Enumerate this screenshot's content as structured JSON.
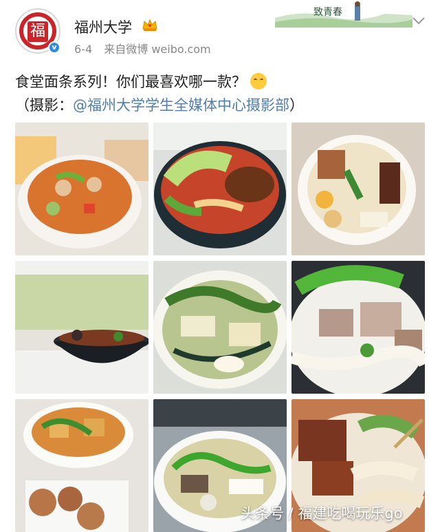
{
  "post": {
    "username": "福州大学",
    "date": "6-4",
    "source": "来自微博 weibo.com",
    "text": "食堂面条系列！你们最喜欢哪一款？",
    "credit_prefix": "（摄影：",
    "mention": "@福州大学学生全媒体中心摄影部",
    "credit_suffix": "）",
    "emoji": "smirk-emoji"
  },
  "avatar": {
    "seal_text": "福",
    "logo_text": "福州大学 FUZHOU UNIVERSITY"
  },
  "banner": {
    "text": "致青春"
  },
  "photos": [
    {
      "label": "curry-noodle-photo"
    },
    {
      "label": "spicy-beef-noodle-photo"
    },
    {
      "label": "braised-meat-noodle-photo"
    },
    {
      "label": "window-noodle-bowl-photo"
    },
    {
      "label": "kelp-tofu-noodle-photo"
    },
    {
      "label": "pork-rib-noodle-photo"
    },
    {
      "label": "fried-tofu-noodle-photo"
    },
    {
      "label": "vegetable-noodle-photo"
    },
    {
      "label": "braised-beef-flat-noodle-photo"
    }
  ],
  "watermark": "头条号 / 福建吃喝玩乐go",
  "colors": {
    "accent_red": "#c9262b",
    "verified_blue": "#2a8de0",
    "mention_blue": "#507daf",
    "meta_gray": "#888888"
  }
}
